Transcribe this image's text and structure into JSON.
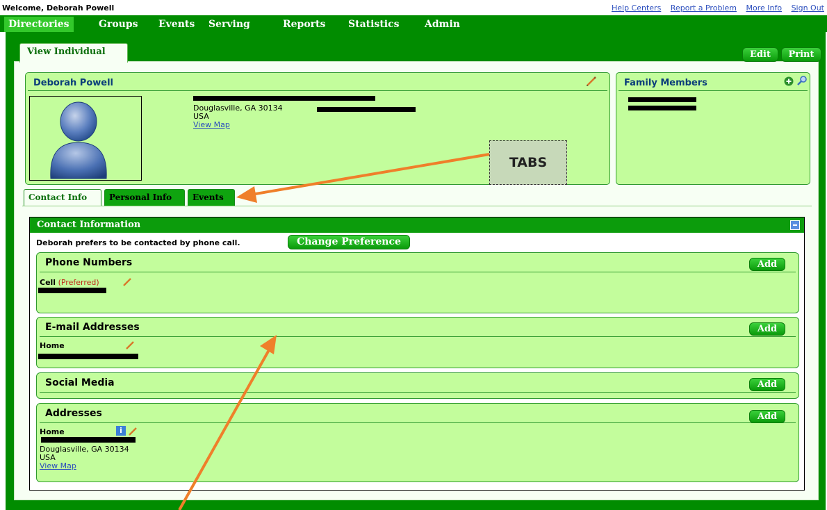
{
  "header": {
    "welcome": "Welcome, Deborah Powell",
    "links": [
      "Help Centers",
      "Report a Problem",
      "More Info",
      "Sign Out"
    ]
  },
  "nav": {
    "items": [
      "Directories",
      "Groups",
      "Events",
      "Serving",
      "Reports",
      "Statistics",
      "Admin"
    ],
    "active": "Directories"
  },
  "page": {
    "tab_label": "View Individual",
    "edit_label": "Edit",
    "print_label": "Print"
  },
  "profile": {
    "name": "Deborah Powell",
    "address_line": "Douglasville, GA 30134",
    "country": "USA",
    "view_map": "View Map"
  },
  "family": {
    "title": "Family Members"
  },
  "annotation": {
    "tabs_callout": "TABS"
  },
  "subtabs": [
    "Contact Info",
    "Personal Info",
    "Events"
  ],
  "contact": {
    "header": "Contact Information",
    "preference_text": "Deborah prefers to be contacted by phone call.",
    "change_pref_label": "Change Preference",
    "add_label": "Add",
    "phone": {
      "title": "Phone Numbers",
      "type": "Cell",
      "preferred": "(Preferred)"
    },
    "email": {
      "title": "E-mail Addresses",
      "type": "Home"
    },
    "social": {
      "title": "Social Media"
    },
    "addresses": {
      "title": "Addresses",
      "type": "Home",
      "line": "Douglasville, GA 30134",
      "country": "USA",
      "view_map": "View Map"
    }
  },
  "colors": {
    "nav_green": "#018c00",
    "active_nav": "#33c92b",
    "panel_green": "#c3fd9c",
    "arrow_orange": "#ef7f2a",
    "link_blue": "#2a4dbd",
    "preferred_red": "#c02a1a"
  }
}
